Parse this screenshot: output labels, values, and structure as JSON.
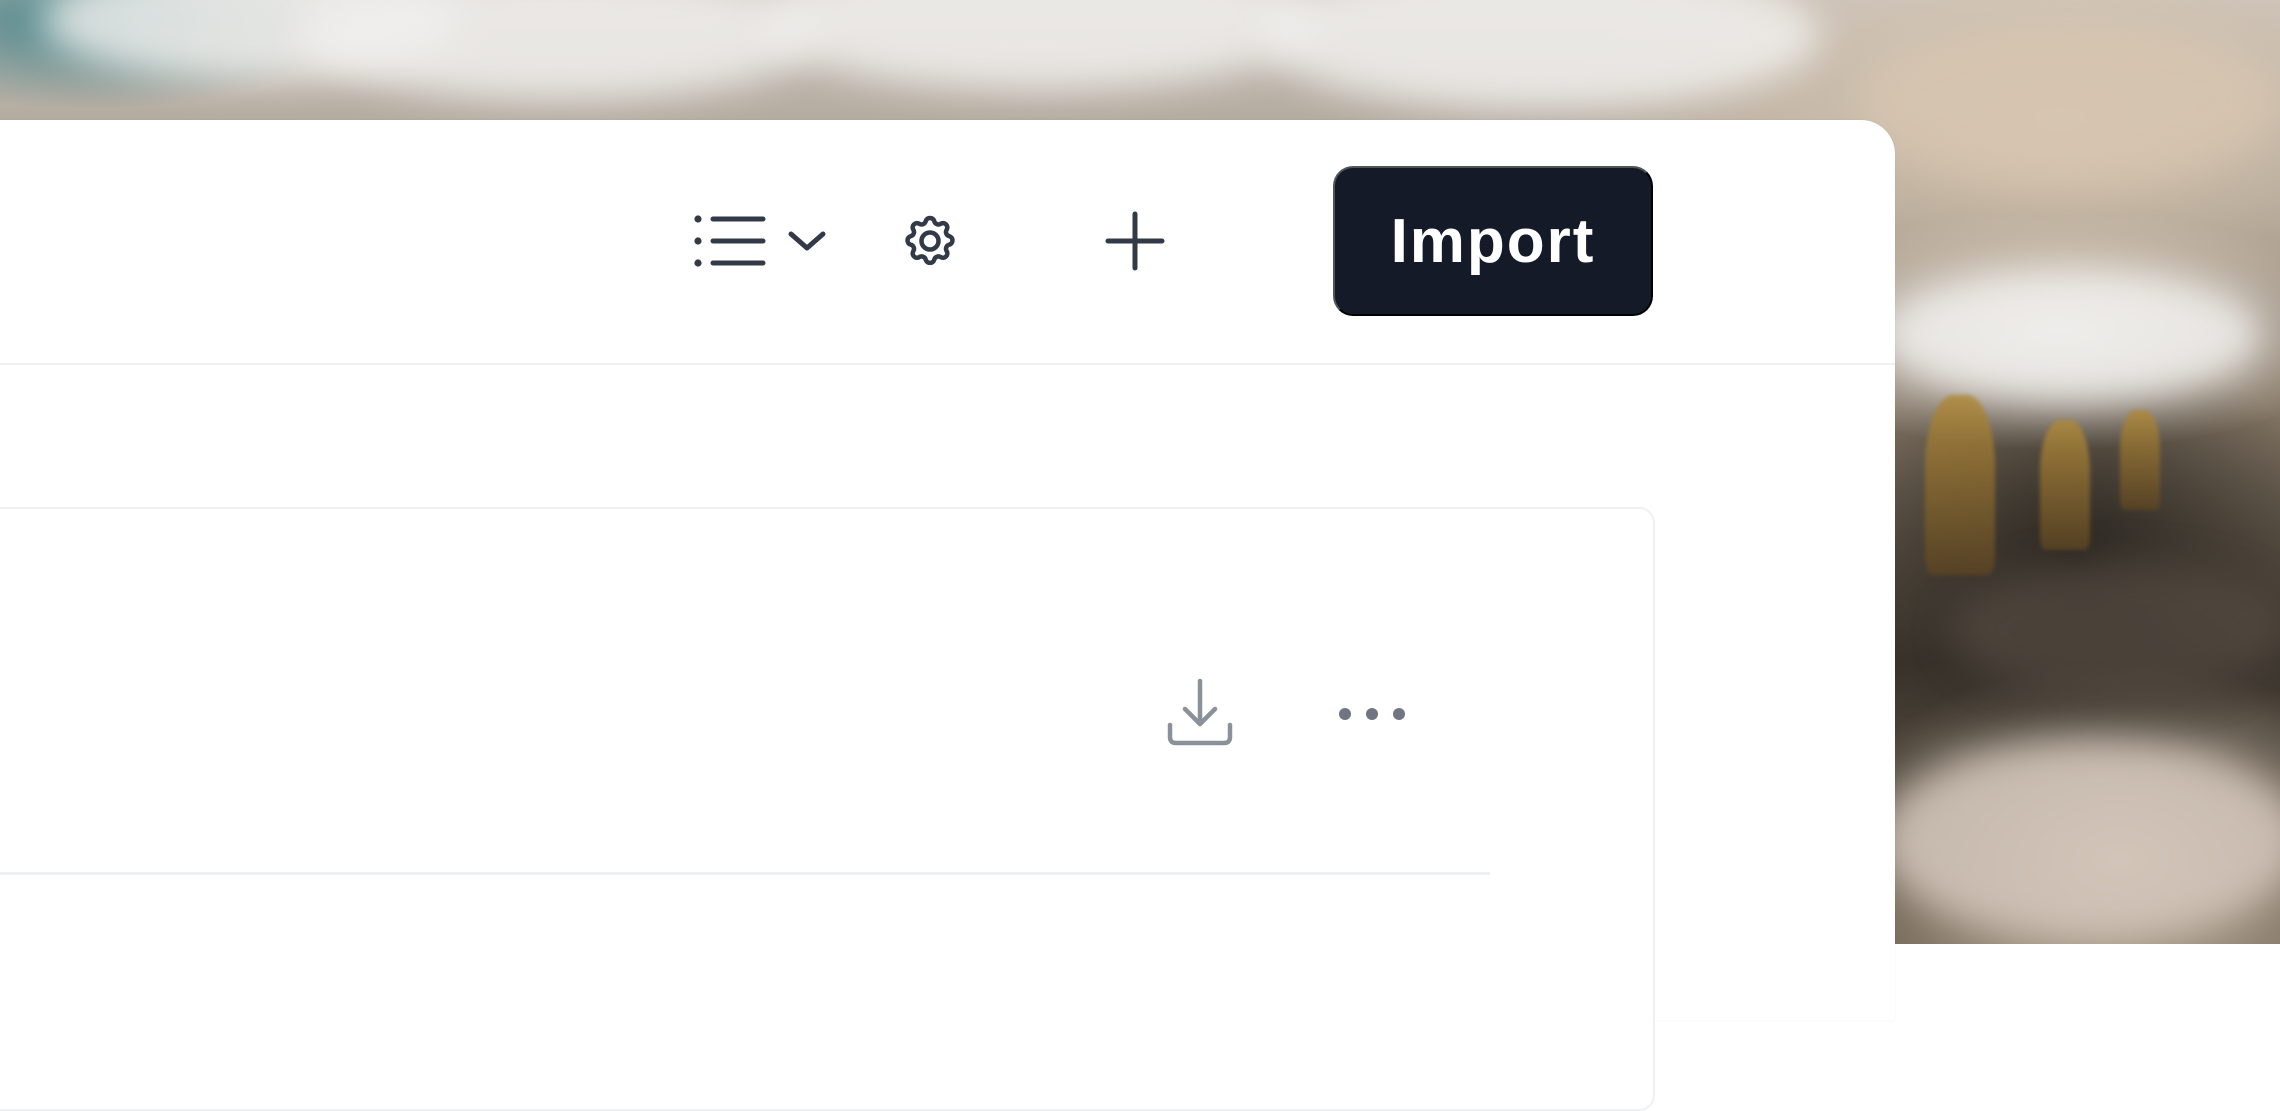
{
  "toolbar": {
    "view_toggle_icon": "list-icon",
    "view_toggle_chevron_icon": "chevron-down-icon",
    "settings_icon": "gear-icon",
    "add_icon": "plus-icon",
    "import_label": "Import"
  },
  "row": {
    "download_icon": "download-icon",
    "more_icon": "more-horizontal-icon"
  },
  "colors": {
    "primary_button_bg": "#151a28",
    "icon_color": "#323a47",
    "muted_icon_color": "#8b919b",
    "divider": "#eef0f2"
  }
}
